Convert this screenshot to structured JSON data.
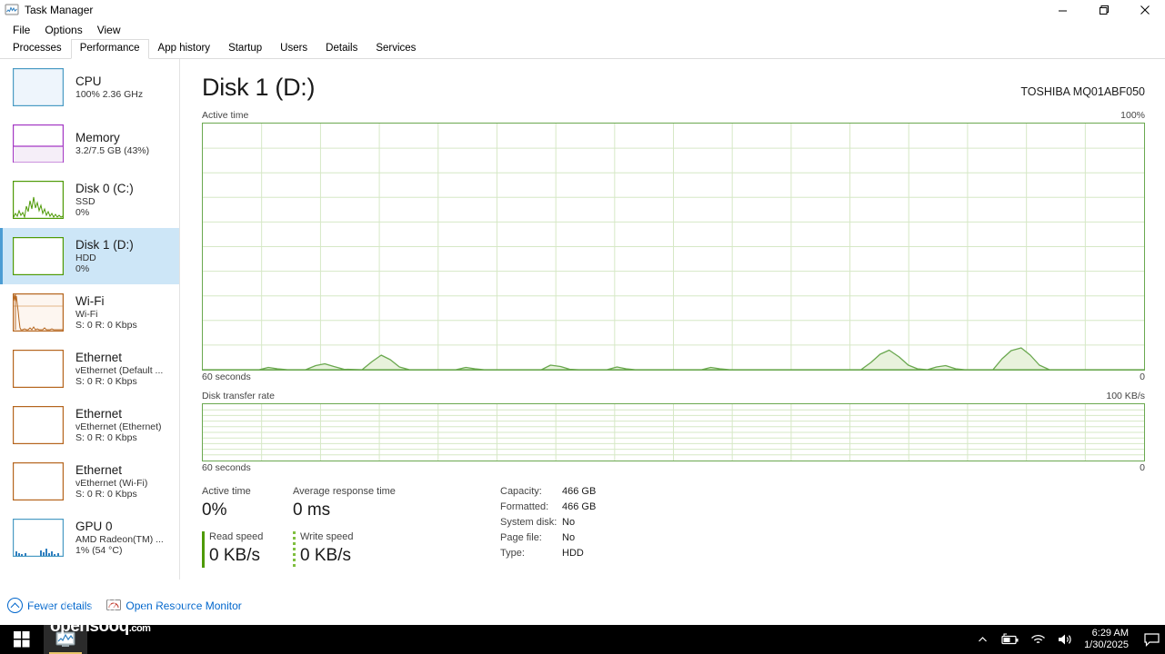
{
  "window": {
    "title": "Task Manager",
    "icon": "task-manager-icon",
    "controls": {
      "minimize": "—",
      "restore": "❐",
      "close": "✕"
    }
  },
  "menu": {
    "items": [
      "File",
      "Options",
      "View"
    ]
  },
  "tabs": {
    "items": [
      "Processes",
      "Performance",
      "App history",
      "Startup",
      "Users",
      "Details",
      "Services"
    ],
    "active": "Performance"
  },
  "sidebar": {
    "items": [
      {
        "name": "CPU",
        "sub": "100%  2.36 GHz",
        "sub2": "",
        "color": "#4a9bc4",
        "selected": false,
        "thumb": "fill"
      },
      {
        "name": "Memory",
        "sub": "3.2/7.5 GB (43%)",
        "sub2": "",
        "color": "#a437c4",
        "selected": false,
        "thumb": "memfill"
      },
      {
        "name": "Disk 0 (C:)",
        "sub": "SSD",
        "sub2": "0%",
        "color": "#4e9a06",
        "selected": false,
        "thumb": "spiky"
      },
      {
        "name": "Disk 1 (D:)",
        "sub": "HDD",
        "sub2": "0%",
        "color": "#4e9a06",
        "selected": true,
        "thumb": "flat"
      },
      {
        "name": "Wi-Fi",
        "sub": "Wi-Fi",
        "sub2": "S: 0 R: 0 Kbps",
        "color": "#b5651d",
        "selected": false,
        "thumb": "wifi"
      },
      {
        "name": "Ethernet",
        "sub": "vEthernet (Default ...",
        "sub2": "S: 0 R: 0 Kbps",
        "color": "#b5651d",
        "selected": false,
        "thumb": "flat"
      },
      {
        "name": "Ethernet",
        "sub": "vEthernet (Ethernet)",
        "sub2": "S: 0 R: 0 Kbps",
        "color": "#b5651d",
        "selected": false,
        "thumb": "flat"
      },
      {
        "name": "Ethernet",
        "sub": "vEthernet (Wi-Fi)",
        "sub2": "S: 0 R: 0 Kbps",
        "color": "#b5651d",
        "selected": false,
        "thumb": "flat"
      },
      {
        "name": "GPU 0",
        "sub": "AMD Radeon(TM) ...",
        "sub2": "1%  (54 °C)",
        "color": "#4a9bc4",
        "selected": false,
        "thumb": "gpu"
      }
    ]
  },
  "main": {
    "title": "Disk 1 (D:)",
    "model": "TOSHIBA MQ01ABF050",
    "graph1": {
      "label": "Active time",
      "max": "100%",
      "xlabel": "60 seconds",
      "min": "0"
    },
    "graph2": {
      "label": "Disk transfer rate",
      "max": "100 KB/s",
      "xlabel": "60 seconds",
      "min": "0"
    },
    "stats": {
      "active_time_label": "Active time",
      "active_time_value": "0%",
      "response_label": "Average response time",
      "response_value": "0 ms",
      "read_label": "Read speed",
      "read_value": "0 KB/s",
      "write_label": "Write speed",
      "write_value": "0 KB/s",
      "details": [
        {
          "key": "Capacity:",
          "value": "466 GB"
        },
        {
          "key": "Formatted:",
          "value": "466 GB"
        },
        {
          "key": "System disk:",
          "value": "No"
        },
        {
          "key": "Page file:",
          "value": "No"
        },
        {
          "key": "Type:",
          "value": "HDD"
        }
      ]
    }
  },
  "statusbar": {
    "fewer_details": "Fewer details",
    "resource_monitor": "Open Resource Monitor"
  },
  "watermark": {
    "text": "opensooq",
    "domain": ".com"
  },
  "taskbar": {
    "start": "start-button",
    "app": "task-manager-taskbar-icon",
    "time": "6:29 AM",
    "date": "1/30/2025"
  },
  "chart_data": [
    {
      "type": "area",
      "title": "Active time",
      "ylabel": "Active time",
      "xlabel": "60 seconds",
      "ylim": [
        0,
        100
      ],
      "ytick_labels": [
        "100%",
        "0"
      ],
      "xtick_labels": [
        "60 seconds",
        "0"
      ],
      "grid": true,
      "color": "#6aa84f",
      "values": [
        0,
        0,
        0,
        0,
        0,
        0,
        0.4,
        0.6,
        0.3,
        0,
        0,
        0.8,
        1.4,
        0.9,
        0.2,
        0,
        0,
        0,
        2.2,
        3.4,
        2.0,
        0.4,
        0,
        0,
        0,
        0,
        0,
        0,
        0.8,
        0.5,
        0,
        0,
        0,
        0,
        0,
        0,
        0,
        1.0,
        0.8,
        0.2,
        0,
        0,
        0,
        0,
        0.6,
        0.4,
        0,
        0,
        0,
        0,
        0,
        0,
        0,
        0,
        0.5,
        0.3,
        0,
        0,
        0,
        0,
        0,
        0,
        0,
        0,
        0,
        0,
        0,
        0,
        0,
        0,
        0,
        0,
        0,
        0,
        1.2,
        2.6,
        3.6,
        2.4,
        1.0,
        0.3,
        0,
        0,
        0.9,
        0.6,
        0.2,
        0,
        0,
        0,
        0,
        1.8,
        3.0,
        3.4,
        2.0,
        0.6,
        0,
        0,
        0,
        0,
        0,
        0,
        0
      ]
    },
    {
      "type": "area",
      "title": "Disk transfer rate",
      "ylabel": "Disk transfer rate",
      "xlabel": "60 seconds",
      "ylim": [
        0,
        100
      ],
      "ytick_labels": [
        "100 KB/s",
        "0"
      ],
      "xtick_labels": [
        "60 seconds",
        "0"
      ],
      "grid": true,
      "color": "#6aa84f",
      "values": [
        0,
        0,
        0,
        0,
        0,
        0,
        0,
        0,
        0,
        0,
        0,
        0,
        0,
        0,
        0,
        0,
        0,
        0,
        0,
        0,
        0,
        0,
        0,
        0,
        0,
        0,
        0,
        0,
        0,
        0,
        0,
        0,
        0,
        0,
        0,
        0,
        0,
        0,
        0,
        0,
        0,
        0,
        0,
        0,
        0,
        0,
        0,
        0,
        0,
        0,
        0,
        0,
        0,
        0,
        0,
        0,
        0,
        0,
        0,
        0
      ]
    }
  ]
}
